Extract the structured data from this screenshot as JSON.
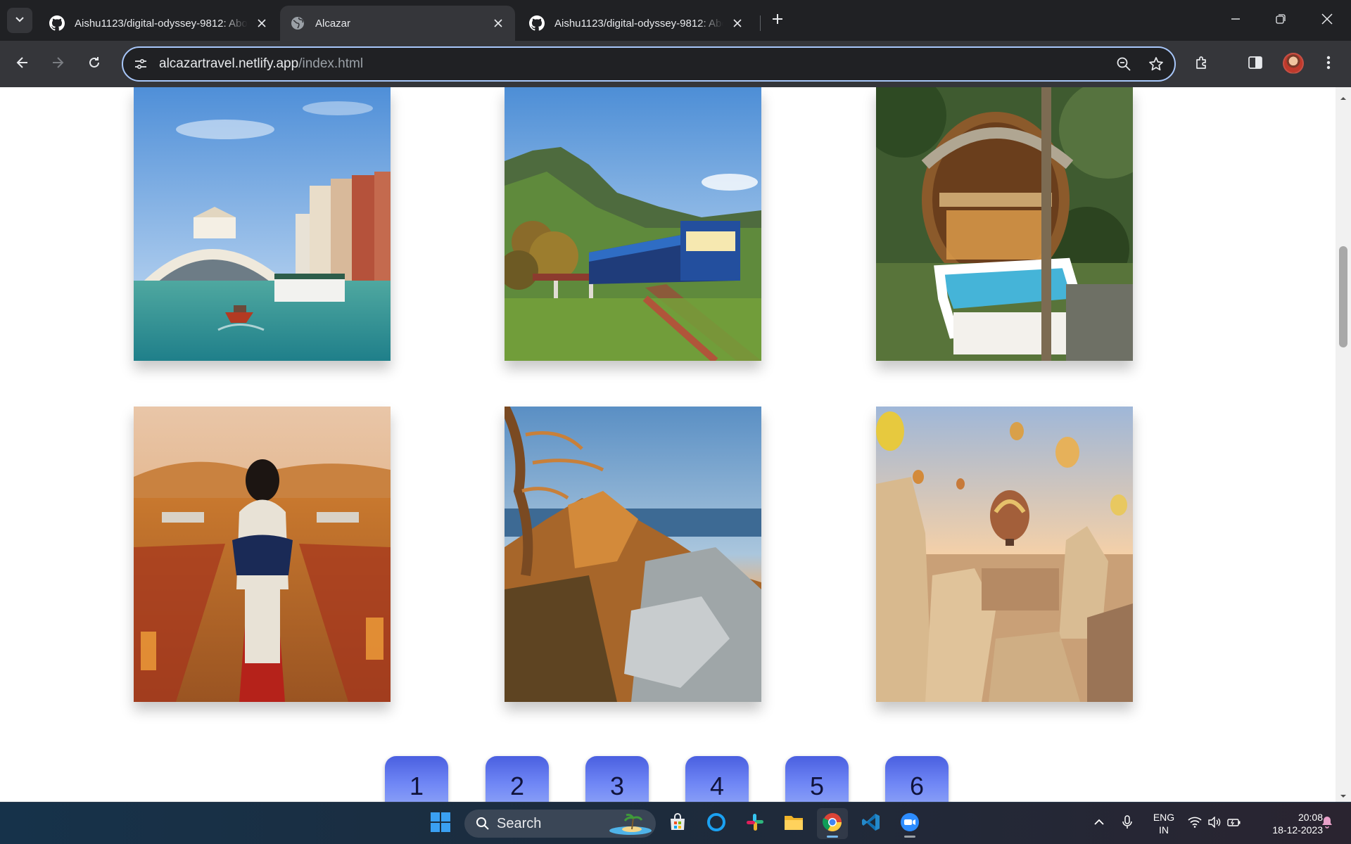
{
  "browser": {
    "tabs": [
      {
        "title": "Aishu1123/digital-odyssey-9812: Abo",
        "favicon": "github-icon",
        "active": false
      },
      {
        "title": "Alcazar",
        "favicon": "globe-icon",
        "active": true
      },
      {
        "title": "Aishu1123/digital-odyssey-9812: Abo",
        "favicon": "github-icon",
        "active": false
      }
    ],
    "url_host": "alcazartravel.netlify.app",
    "url_path": "/index.html",
    "accent_color": "#a8c7fa"
  },
  "page": {
    "images": [
      {
        "name": "venice-rialto-bridge-image"
      },
      {
        "name": "mountain-train-image"
      },
      {
        "name": "bamboo-villa-pool-image"
      },
      {
        "name": "desert-camp-image"
      },
      {
        "name": "mountain-sunset-image"
      },
      {
        "name": "cappadocia-balloons-image"
      }
    ],
    "pagination": [
      "1",
      "2",
      "3",
      "4",
      "5",
      "6"
    ],
    "button_color": "#5b72ee"
  },
  "taskbar": {
    "search_label": "Search",
    "language_line1": "ENG",
    "language_line2": "IN",
    "time": "20:08",
    "date": "18-12-2023",
    "apps": [
      "start-icon",
      "microsoft-store-icon",
      "cortana-icon",
      "slack-icon",
      "file-explorer-icon",
      "chrome-icon",
      "vscode-icon",
      "zoom-icon"
    ]
  }
}
